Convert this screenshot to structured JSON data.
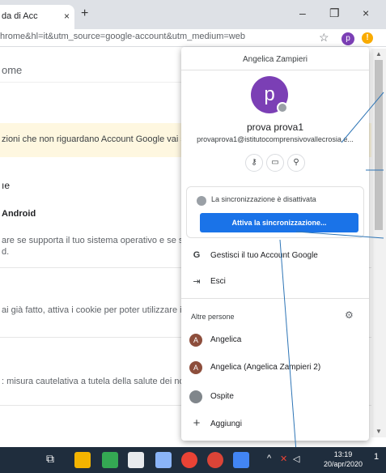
{
  "browser": {
    "tab_title": "da di Acc",
    "tab_close": "×",
    "new_tab": "+",
    "minimize": "–",
    "restore": "❐",
    "close": "×",
    "url": "hrome&hl=it&utm_source=google-account&utm_medium=web",
    "profile_initial": "p",
    "alert_icon": "!"
  },
  "page": {
    "search_text": "ome",
    "notice": "zioni che non riguardano Account Google vai su",
    "heading_1": "ıe",
    "heading_android": "Android",
    "text_1a": "are se supporta il tuo sistema operativo e se se",
    "text_1b": "d.",
    "text_2": "ai già fatto, attiva i cookie per poter utilizzare il",
    "text_3": ": misura cautelativa a tutela della salute dei nos"
  },
  "popup": {
    "account_name": "Angelica Zampieri",
    "avatar_initial": "p",
    "display_name": "prova prova1",
    "email": "provaprova1@istitutocomprensivovallecrosia.e...",
    "sync_status": "La sincronizzazione è disattivata",
    "sync_button": "Attiva la sincronizzazione...",
    "manage_account": "Gestisci il tuo Account Google",
    "logout": "Esci",
    "other_people_label": "Altre persone",
    "people": [
      {
        "initial": "A",
        "name": "Angelica"
      },
      {
        "initial": "A",
        "name": "Angelica (Angelica Zampieri 2)"
      }
    ],
    "guest": "Ospite",
    "add": "Aggiungi"
  },
  "taskbar": {
    "time": "13:19",
    "date": "20/apr/2020",
    "notification_count": "1"
  },
  "colors": {
    "accent_blue": "#1a73e8",
    "profile_purple": "#7b3fb5",
    "person_avatar": "#8d4e3c",
    "notice_yellow": "#fef7e0",
    "taskbar": "#1f2d3d"
  }
}
